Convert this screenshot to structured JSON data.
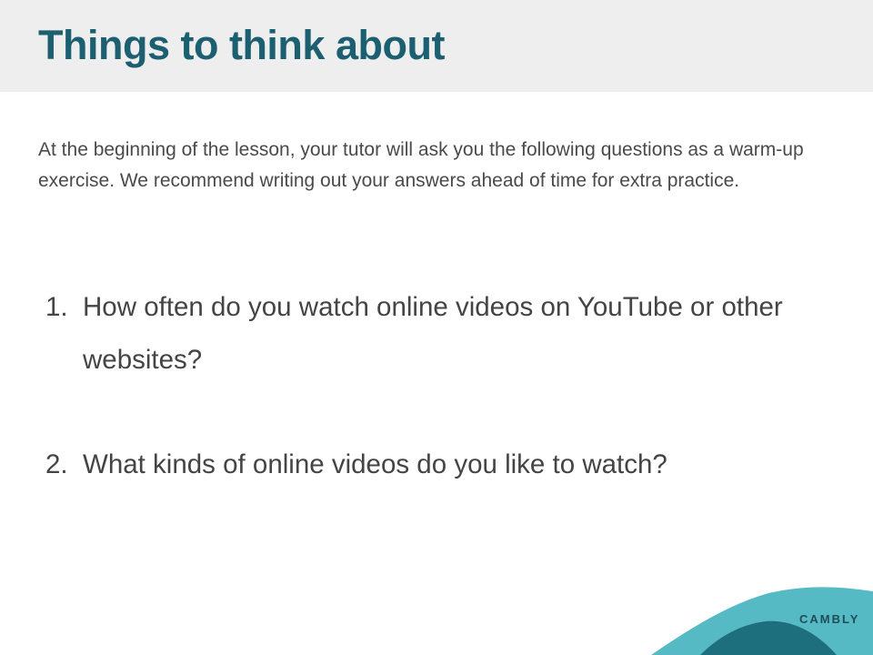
{
  "slide": {
    "title": "Things to think about",
    "intro": "At the beginning of the lesson, your tutor will ask you the following questions as a warm-up exercise. We recommend writing out your answers ahead of time for extra practice.",
    "questions": [
      {
        "number": "1.",
        "text": "How often do you watch online videos on YouTube or other websites?"
      },
      {
        "number": "2.",
        "text": "What kinds of online videos do you like to watch?"
      }
    ]
  },
  "brand": {
    "name": "CAMBLY",
    "colors": {
      "title": "#1c5f70",
      "wave_light": "#56bac4",
      "wave_dark": "#1e6f7e"
    }
  }
}
